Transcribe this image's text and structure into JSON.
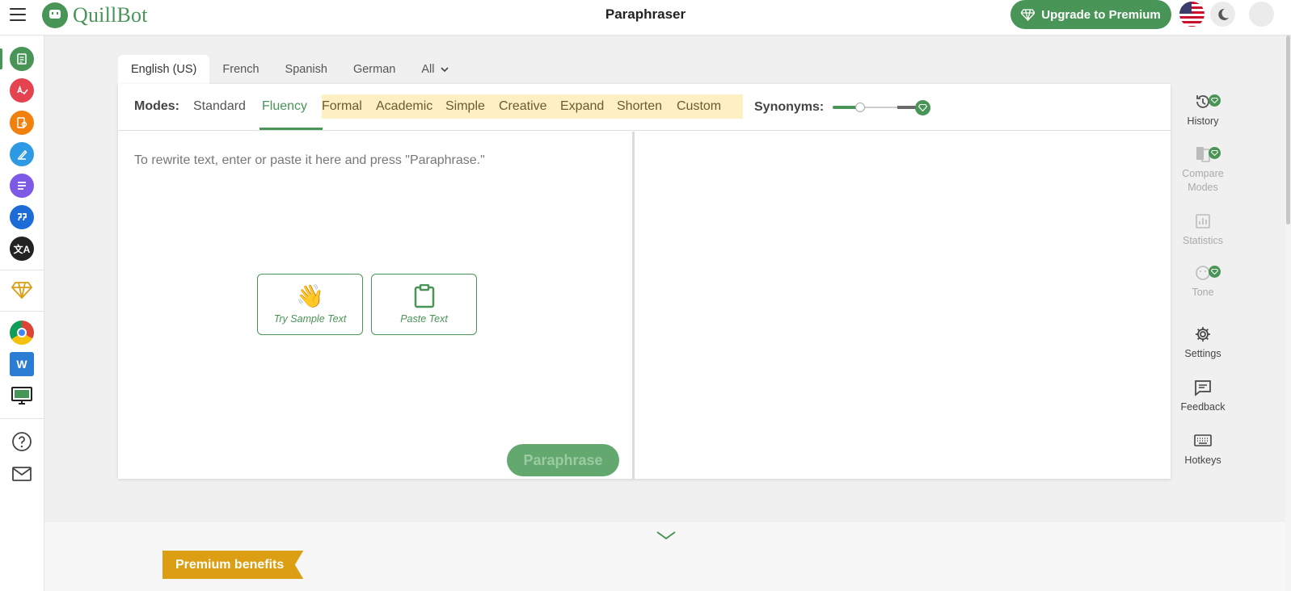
{
  "app": {
    "name": "QuillBot",
    "page_title": "Paraphraser",
    "upgrade_label": "Upgrade to Premium"
  },
  "header": {
    "logo_icon": "quillbot-robot-icon",
    "theme_icon": "moon-icon",
    "language_flag": "us-flag-icon"
  },
  "left_sidebar": {
    "items": [
      {
        "icon": "paraphraser-icon",
        "color": "#499557",
        "active": true
      },
      {
        "icon": "grammar-checker-icon",
        "color": "#e5434f"
      },
      {
        "icon": "plagiarism-checker-icon",
        "color": "#f2800d"
      },
      {
        "icon": "co-writer-icon",
        "color": "#2e9ae4"
      },
      {
        "icon": "summarizer-icon",
        "color": "#7d5ae6"
      },
      {
        "icon": "citation-generator-icon",
        "color": "#1d6bd6"
      },
      {
        "icon": "translator-icon",
        "color": "#222222"
      },
      {
        "icon": "premium-gem-icon",
        "color": "#dc9e12"
      },
      {
        "icon": "chrome-extension-icon"
      },
      {
        "icon": "word-addin-icon"
      },
      {
        "icon": "desktop-app-icon"
      },
      {
        "icon": "help-icon"
      },
      {
        "icon": "mail-icon"
      }
    ]
  },
  "language_tabs": [
    "English (US)",
    "French",
    "Spanish",
    "German",
    "All"
  ],
  "modes": {
    "label": "Modes:",
    "items": [
      "Standard",
      "Fluency",
      "Formal",
      "Academic",
      "Simple",
      "Creative",
      "Expand",
      "Shorten",
      "Custom"
    ],
    "active": "Fluency",
    "synonyms_label": "Synonyms:"
  },
  "input": {
    "placeholder": "To rewrite text, enter or paste it here and press \"Paraphrase.\"",
    "sample_label": "Try Sample Text",
    "paste_label": "Paste Text",
    "paraphrase_label": "Paraphrase"
  },
  "right_toolbar": [
    "History",
    "Compare Modes",
    "Statistics",
    "Tone",
    "Settings",
    "Feedback",
    "Hotkeys"
  ],
  "bottom": {
    "premium_badge": "Premium benefits"
  },
  "colors": {
    "brand": "#499557",
    "premium": "#dc9e12",
    "premium_bg": "#fdf0c4"
  }
}
